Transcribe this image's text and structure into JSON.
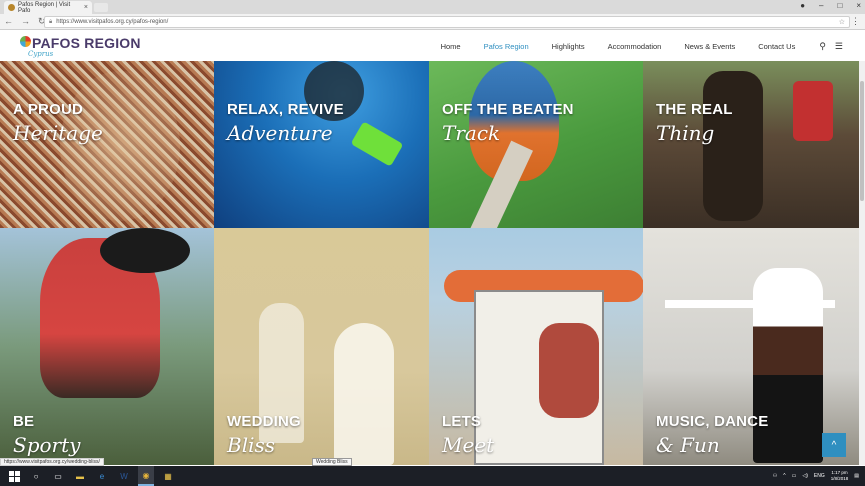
{
  "browser": {
    "tab_title": "Pafos Region | Visit Pafo",
    "address": "https://www.visitpafos.org.cy/pafos-region/",
    "colors": {
      "tabbar": "#dadada",
      "toolbar": "#f2f2f2"
    }
  },
  "site": {
    "logo_text": "PAFOS REGION",
    "logo_sub": "Cyprus",
    "nav": [
      "Home",
      "Pafos Region",
      "Highlights",
      "Accommodation",
      "News & Events",
      "Contact Us"
    ],
    "active_nav": "Pafos Region",
    "accent": "#2f8fc0"
  },
  "tiles": [
    {
      "line1": "A PROUD",
      "line2": "Heritage"
    },
    {
      "line1": "RELAX, REVIVE",
      "line2": "Adventure"
    },
    {
      "line1": "OFF THE BEATEN",
      "line2": "Track"
    },
    {
      "line1": "THE REAL",
      "line2": "Thing"
    },
    {
      "line1": "BE",
      "line2": "Sporty"
    },
    {
      "line1": "WEDDING",
      "line2": "Bliss"
    },
    {
      "line1": "LETS",
      "line2": "Meet"
    },
    {
      "line1": "MUSIC, DANCE",
      "line2": "& Fun"
    }
  ],
  "status": {
    "link_url": "https://www.visitpafos.org.cy/wedding-bliss/",
    "tooltip": "Wedding Bliss"
  },
  "taskbar": {
    "lang": "ENG",
    "time": "1:17 pm",
    "date": "1/8/2018"
  }
}
